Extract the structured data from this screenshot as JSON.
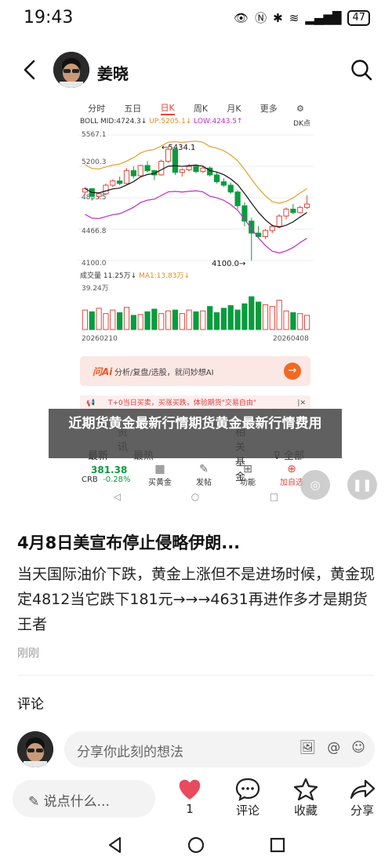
{
  "status_bar": {
    "time": "19:43",
    "battery": "47"
  },
  "header": {
    "username": "姜晓"
  },
  "shot": {
    "tabs": [
      "分时",
      "五日",
      "日K",
      "周K",
      "月K",
      "更多"
    ],
    "active_tab": "日K",
    "boll": {
      "boll_label": "BOLL",
      "mid": "MID:4724.3↓",
      "up": "UP:5205.1↓",
      "low": "LOW:4243.5↑",
      "dk": "DK点"
    },
    "k_axis": [
      "5567.1",
      "5200.3",
      "4833.5",
      "4466.8",
      "4100.0"
    ],
    "k_annotations": {
      "high": "5434.1",
      "low": "4100.0"
    },
    "volume": {
      "label": "成交量",
      "value": "11.25万↓",
      "ma": "MA1:13.83万↓",
      "axis_top": "39.24万"
    },
    "dates": {
      "start": "20260210",
      "end": "20260408"
    },
    "ai": {
      "logo": "问Ai",
      "text": "分析/复盘/选股，就问妙想AI"
    },
    "promo": {
      "text": "T+0当日买卖，买涨买跌，体验期货\"交易自由\""
    },
    "news_tabs": "资讯",
    "news_tabs_right": "相关基金",
    "filter": {
      "sort1": "最新",
      "sort2": "最热",
      "all": "全部"
    },
    "quote": {
      "price": "381.38",
      "code": "CRB",
      "change": "-0.28%"
    },
    "actions": [
      "买黄金",
      "发帖",
      "功能",
      "加自选"
    ]
  },
  "overlay": {
    "text": "近期货黄金最新行情期货黄金最新行情费用"
  },
  "post": {
    "title": "4月8日美宣布停止侵略伊朗...",
    "body": "当天国际油价下跌，黄金上涨但不是进场时候，黄金现定4812当它跌下181元→→→4631再进作多才是期货王者",
    "time": "刚刚"
  },
  "comments": {
    "label": "评论",
    "placeholder": "分享你此刻的想法"
  },
  "bottom_bar": {
    "input_placeholder": "说点什么...",
    "like_count": "1",
    "comment_label": "评论",
    "collect_label": "收藏",
    "share_label": "分享"
  },
  "colors": {
    "accent": "#e0483c",
    "up_red": "#e0483c",
    "down_green": "#0a9b3e"
  },
  "chart_data": {
    "type": "bar",
    "title": "",
    "xlabel": "",
    "ylabel": "",
    "x_range": [
      "20260210",
      "20260408"
    ],
    "ylim": [
      4100.0,
      5567.1
    ],
    "candles": [
      [
        4900,
        4960,
        4870,
        4940
      ],
      [
        4940,
        4930,
        4800,
        4850
      ],
      [
        4850,
        4900,
        4820,
        4880
      ],
      [
        4880,
        5000,
        4860,
        4980
      ],
      [
        4980,
        5050,
        4960,
        5030
      ],
      [
        5030,
        5080,
        4980,
        5000
      ],
      [
        5000,
        5180,
        4990,
        5150
      ],
      [
        5150,
        5200,
        5060,
        5090
      ],
      [
        5090,
        5220,
        5080,
        5210
      ],
      [
        5210,
        5260,
        5130,
        5150
      ],
      [
        5150,
        5160,
        5040,
        5100
      ],
      [
        5100,
        5280,
        5090,
        5260
      ],
      [
        5260,
        5434,
        5240,
        5400
      ],
      [
        5400,
        5420,
        5100,
        5130
      ],
      [
        5130,
        5180,
        5080,
        5160
      ],
      [
        5160,
        5230,
        5140,
        5200
      ],
      [
        5200,
        5220,
        5120,
        5140
      ],
      [
        5140,
        5200,
        5120,
        5180
      ],
      [
        5180,
        5200,
        5080,
        5100
      ],
      [
        5100,
        5130,
        5000,
        5020
      ],
      [
        5020,
        5060,
        4960,
        4980
      ],
      [
        4980,
        5010,
        4880,
        4900
      ],
      [
        4900,
        4920,
        4700,
        4740
      ],
      [
        4740,
        4780,
        4500,
        4560
      ],
      [
        4560,
        4600,
        4100,
        4420
      ],
      [
        4420,
        4500,
        4360,
        4380
      ],
      [
        4380,
        4470,
        4350,
        4450
      ],
      [
        4450,
        4520,
        4420,
        4500
      ],
      [
        4500,
        4640,
        4480,
        4620
      ],
      [
        4620,
        4720,
        4580,
        4700
      ],
      [
        4700,
        4760,
        4640,
        4660
      ],
      [
        4660,
        4740,
        4650,
        4720
      ],
      [
        4720,
        4860,
        4700,
        4760
      ]
    ],
    "volumes": [
      22,
      20,
      24,
      18,
      22,
      19,
      25,
      16,
      17,
      20,
      23,
      18,
      21,
      22,
      18,
      22,
      20,
      21,
      26,
      19,
      24,
      27,
      22,
      29,
      37,
      31,
      28,
      26,
      33,
      21,
      19,
      18,
      16
    ]
  }
}
